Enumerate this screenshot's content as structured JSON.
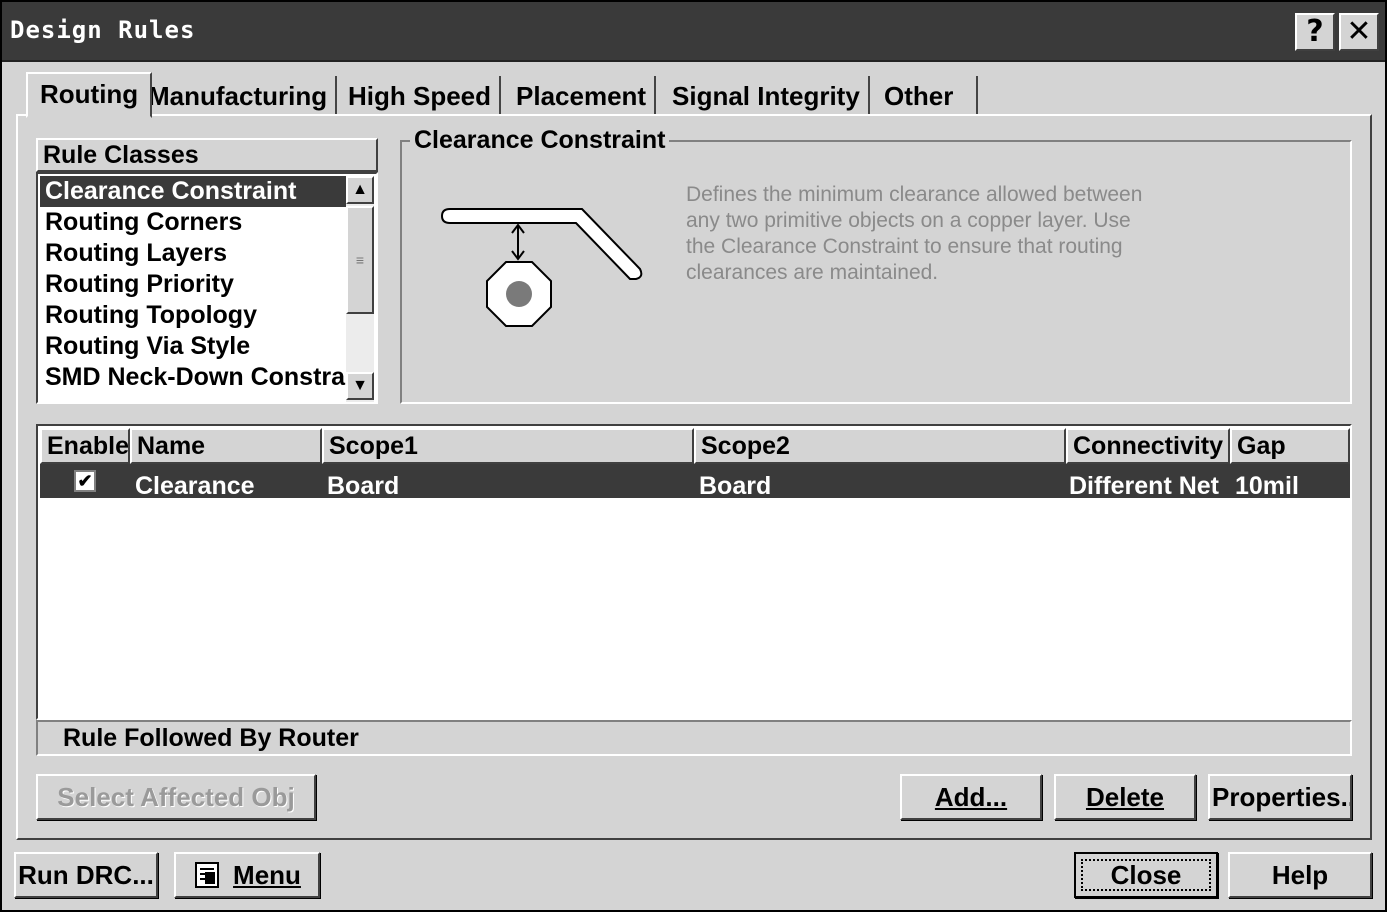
{
  "window": {
    "title": "Design Rules",
    "help_glyph": "?",
    "close_glyph": "✕"
  },
  "tabs": [
    {
      "label": "Routing",
      "active": true
    },
    {
      "label": "Manufacturing"
    },
    {
      "label": "High Speed"
    },
    {
      "label": "Placement"
    },
    {
      "label": "Signal Integrity"
    },
    {
      "label": "Other"
    }
  ],
  "rule_classes": {
    "header": "Rule Classes",
    "items": [
      "Clearance Constraint",
      "Routing Corners",
      "Routing Layers",
      "Routing Priority",
      "Routing Topology",
      "Routing Via Style",
      "SMD Neck-Down Constraint"
    ],
    "selected_index": 0
  },
  "constraint_panel": {
    "title": "Clearance Constraint",
    "description": "Defines the minimum clearance allowed between any two primitive objects on a copper layer. Use the Clearance Constraint to ensure that routing clearances are maintained."
  },
  "rules_grid": {
    "columns": [
      "Enable",
      "Name",
      "Scope1",
      "Scope2",
      "Connectivity",
      "Gap"
    ],
    "rows": [
      {
        "enabled": true,
        "name": "Clearance",
        "scope1": "Board",
        "scope2": "Board",
        "connectivity": "Different Net",
        "gap": "10mil"
      }
    ]
  },
  "status_text": "Rule Followed By Router",
  "buttons": {
    "select_affected": "Select Affected Obj",
    "add": "Add...",
    "delete": "Delete",
    "properties": "Properties...",
    "run_drc": "Run DRC...",
    "menu": "Menu",
    "close": "Close",
    "help": "Help"
  }
}
